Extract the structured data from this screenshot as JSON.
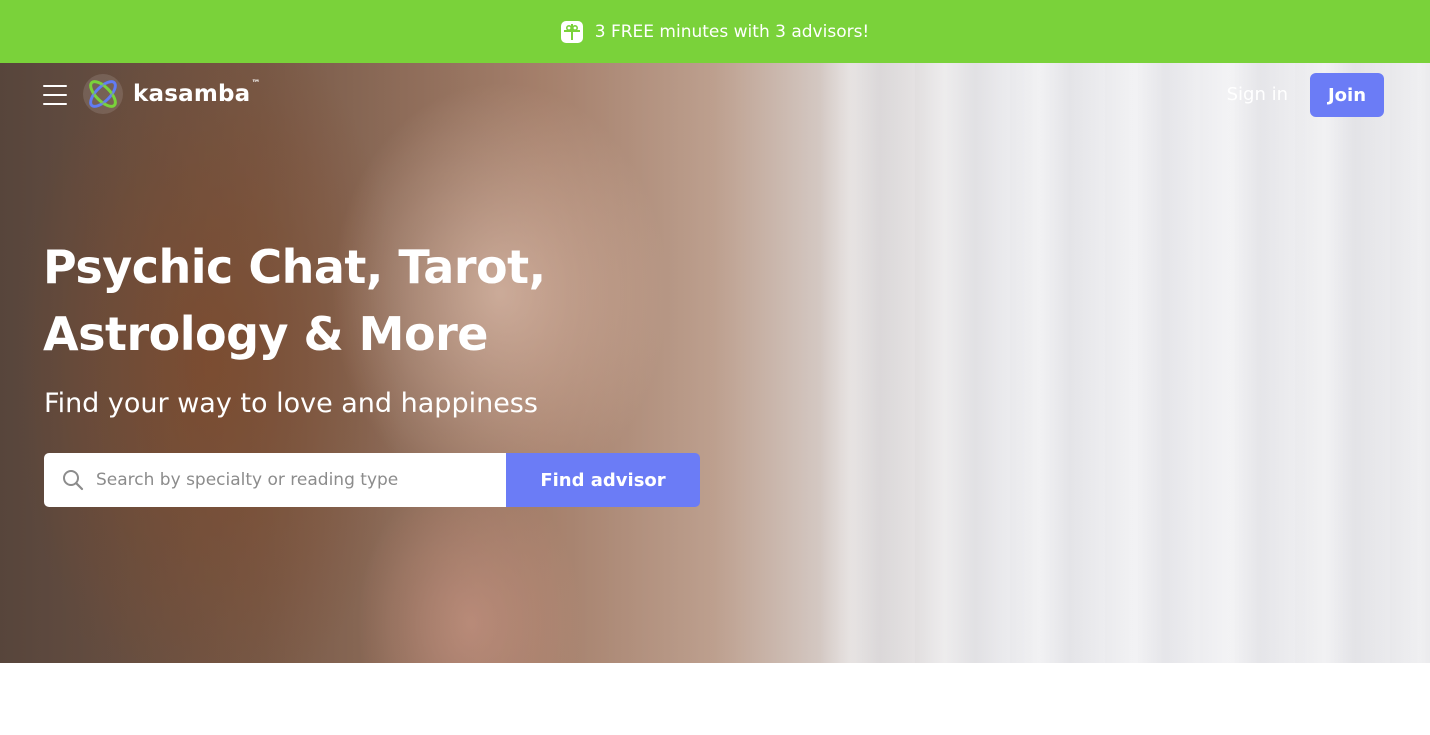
{
  "promo": {
    "text": "3 FREE minutes with 3 advisors!",
    "icon": "gift-icon"
  },
  "header": {
    "menu_icon": "hamburger-menu-icon",
    "logo_text": "kasamba",
    "logo_tm": "™",
    "sign_in": "Sign in",
    "join": "Join"
  },
  "hero": {
    "headline_line1": "Psychic Chat, Tarot,",
    "headline_line2": "Astrology & More",
    "subheadline": "Find your way to love and happiness"
  },
  "search": {
    "icon": "search-icon",
    "placeholder": "Search by specialty or reading type",
    "value": "",
    "button_label": "Find advisor"
  },
  "colors": {
    "promo_bg": "#7ad23a",
    "accent": "#6b7cf6",
    "text_on_dark": "#ffffff"
  }
}
